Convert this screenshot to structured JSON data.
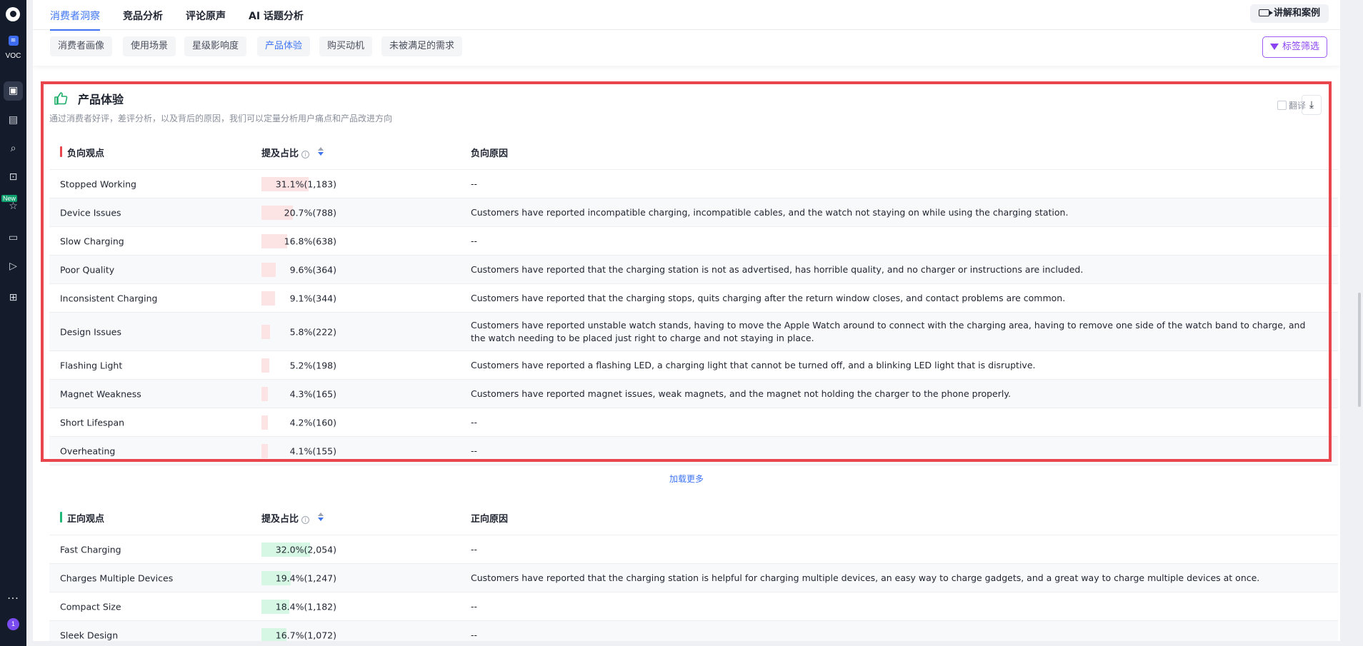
{
  "sidebar": {
    "app_label": "VOC",
    "new_badge": "New",
    "avatar_text": "1",
    "icons": [
      "chat-icon",
      "document-icon",
      "search-icon",
      "insight-icon",
      "star-icon",
      "message-icon",
      "video-icon",
      "apps-icon"
    ]
  },
  "topbar": {
    "tabs": [
      "消费者洞察",
      "竞品分析",
      "评论原声",
      "AI 话题分析"
    ],
    "explain_button": "讲解和案例"
  },
  "subtabs": {
    "items": [
      "消费者画像",
      "使用场景",
      "星级影响度",
      "产品体验",
      "购买动机",
      "未被满足的需求"
    ],
    "active": "产品体验",
    "filter_button": "标签筛选"
  },
  "section": {
    "title": "产品体验",
    "description": "通过消费者好评，差评分析，以及背后的原因，我们可以定量分析用户痛点和产品改进方向",
    "translate_label": "翻译"
  },
  "negative": {
    "headers": {
      "opinion": "负向观点",
      "ratio": "提及占比",
      "reason": "负向原因"
    },
    "accent": "#e8454d",
    "bar_color": "#fde4e4",
    "rows": [
      {
        "name": "Stopped Working",
        "pct": 31.1,
        "label": "31.1%(1,183)",
        "reason": "--"
      },
      {
        "name": "Device Issues",
        "pct": 20.7,
        "label": "20.7%(788)",
        "reason": "Customers have reported incompatible charging, incompatible cables, and the watch not staying on while using the charging station."
      },
      {
        "name": "Slow Charging",
        "pct": 16.8,
        "label": "16.8%(638)",
        "reason": "--"
      },
      {
        "name": "Poor Quality",
        "pct": 9.6,
        "label": "9.6%(364)",
        "reason": "Customers have reported that the charging station is not as advertised, has horrible quality, and no charger or instructions are included."
      },
      {
        "name": "Inconsistent Charging",
        "pct": 9.1,
        "label": "9.1%(344)",
        "reason": "Customers have reported that the charging stops, quits charging after the return window closes, and contact problems are common."
      },
      {
        "name": "Design Issues",
        "pct": 5.8,
        "label": "5.8%(222)",
        "reason": "Customers have reported unstable watch stands, having to move the Apple Watch around to connect with the charging area, having to remove one side of the watch band to charge, and the watch needing to be placed just right to charge and not staying in place."
      },
      {
        "name": "Flashing Light",
        "pct": 5.2,
        "label": "5.2%(198)",
        "reason": "Customers have reported a flashing LED, a charging light that cannot be turned off, and a blinking LED light that is disruptive."
      },
      {
        "name": "Magnet Weakness",
        "pct": 4.3,
        "label": "4.3%(165)",
        "reason": "Customers have reported magnet issues, weak magnets, and the magnet not holding the charger to the phone properly."
      },
      {
        "name": "Short Lifespan",
        "pct": 4.2,
        "label": "4.2%(160)",
        "reason": "--"
      },
      {
        "name": "Overheating",
        "pct": 4.1,
        "label": "4.1%(155)",
        "reason": "--"
      }
    ]
  },
  "load_more": "加载更多",
  "positive": {
    "headers": {
      "opinion": "正向观点",
      "ratio": "提及占比",
      "reason": "正向原因"
    },
    "accent": "#1fb877",
    "bar_color": "#d6f7e3",
    "rows": [
      {
        "name": "Fast Charging",
        "pct": 32.0,
        "label": "32.0%(2,054)",
        "reason": "--"
      },
      {
        "name": "Charges Multiple Devices",
        "pct": 19.4,
        "label": "19.4%(1,247)",
        "reason": "Customers have reported that the charging station is helpful for charging multiple devices, an easy way to charge gadgets, and a great way to charge multiple devices at once."
      },
      {
        "name": "Compact Size",
        "pct": 18.4,
        "label": "18.4%(1,182)",
        "reason": "--"
      },
      {
        "name": "Sleek Design",
        "pct": 16.7,
        "label": "16.7%(1,072)",
        "reason": "--"
      }
    ]
  }
}
